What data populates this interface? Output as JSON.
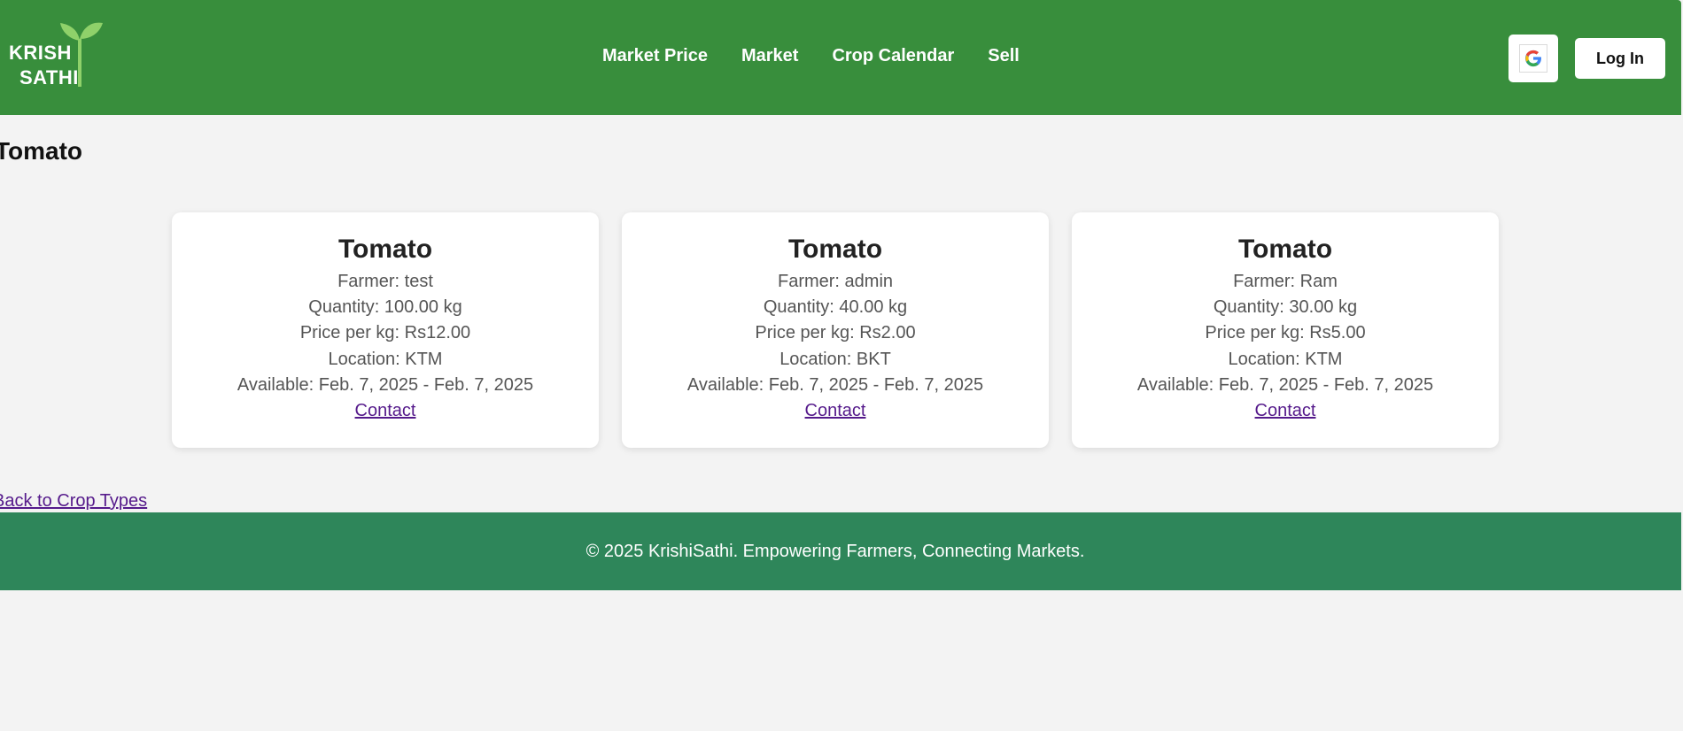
{
  "brand": {
    "logo_line1": "KRISH",
    "logo_line2": "SATHI",
    "colors": {
      "navbar": "#388e3c",
      "footer": "#2e865a",
      "sprout": "#8fd16a",
      "link": "#551a8b",
      "background": "#f3f3f3"
    }
  },
  "nav": {
    "links": [
      {
        "label": "Market Price"
      },
      {
        "label": "Market"
      },
      {
        "label": "Crop Calendar"
      },
      {
        "label": "Sell"
      }
    ],
    "google_icon": "google-icon",
    "login_label": "Log In"
  },
  "page": {
    "title": "Tomato"
  },
  "listings": [
    {
      "crop": "Tomato",
      "farmer": "Farmer: test",
      "quantity": "Quantity: 100.00 kg",
      "price": "Price per kg: Rs12.00",
      "location": "Location: KTM",
      "available": "Available: Feb. 7, 2025 - Feb. 7, 2025",
      "contact_label": "Contact"
    },
    {
      "crop": "Tomato",
      "farmer": "Farmer: admin",
      "quantity": "Quantity: 40.00 kg",
      "price": "Price per kg: Rs2.00",
      "location": "Location: BKT",
      "available": "Available: Feb. 7, 2025 - Feb. 7, 2025",
      "contact_label": "Contact"
    },
    {
      "crop": "Tomato",
      "farmer": "Farmer: Ram",
      "quantity": "Quantity: 30.00 kg",
      "price": "Price per kg: Rs5.00",
      "location": "Location: KTM",
      "available": "Available: Feb. 7, 2025 - Feb. 7, 2025",
      "contact_label": "Contact"
    }
  ],
  "back_link": "Back to Crop Types",
  "footer": {
    "text": "© 2025 KrishiSathi. Empowering Farmers, Connecting Markets."
  }
}
